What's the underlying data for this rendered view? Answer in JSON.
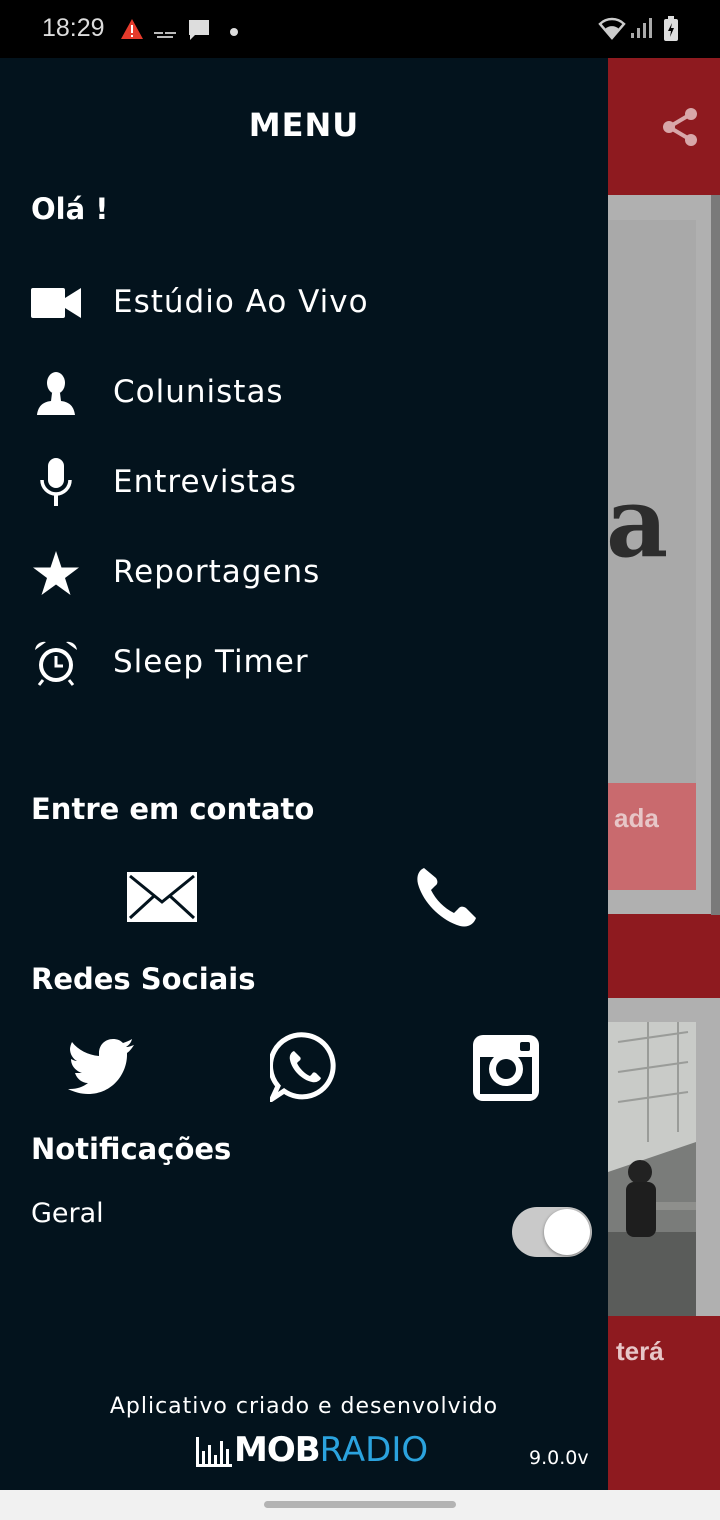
{
  "status_bar": {
    "time": "18:29",
    "icons": [
      "warning-icon",
      "app-notification-icon",
      "chat-icon",
      "dot-icon",
      "wifi-icon",
      "signal-icon",
      "battery-icon"
    ]
  },
  "drawer": {
    "title": "MENU",
    "greeting": "Olá !",
    "items": [
      {
        "label": "Estúdio Ao Vivo",
        "icon": "video-camera-icon"
      },
      {
        "label": "Colunistas",
        "icon": "person-icon"
      },
      {
        "label": "Entrevistas",
        "icon": "microphone-icon"
      },
      {
        "label": "Reportagens",
        "icon": "star-icon"
      },
      {
        "label": "Sleep Timer",
        "icon": "alarm-clock-icon"
      }
    ],
    "contact_title": "Entre em contato",
    "social_title": "Redes Sociais",
    "notifications_title": "Notificações",
    "toggle_label": "Geral",
    "toggle_on": true,
    "credit_text": "Aplicativo criado e desenvolvido",
    "logo_white": "MOB",
    "logo_blue": "RADIO",
    "version": "9.0.0v"
  },
  "background": {
    "card_text_1": "ada",
    "card_text_2": "terá",
    "big_letter": "a"
  },
  "colors": {
    "drawer_bg": "#03131d",
    "brand_red": "#8e1a1f",
    "logo_blue": "#2ba3de"
  }
}
